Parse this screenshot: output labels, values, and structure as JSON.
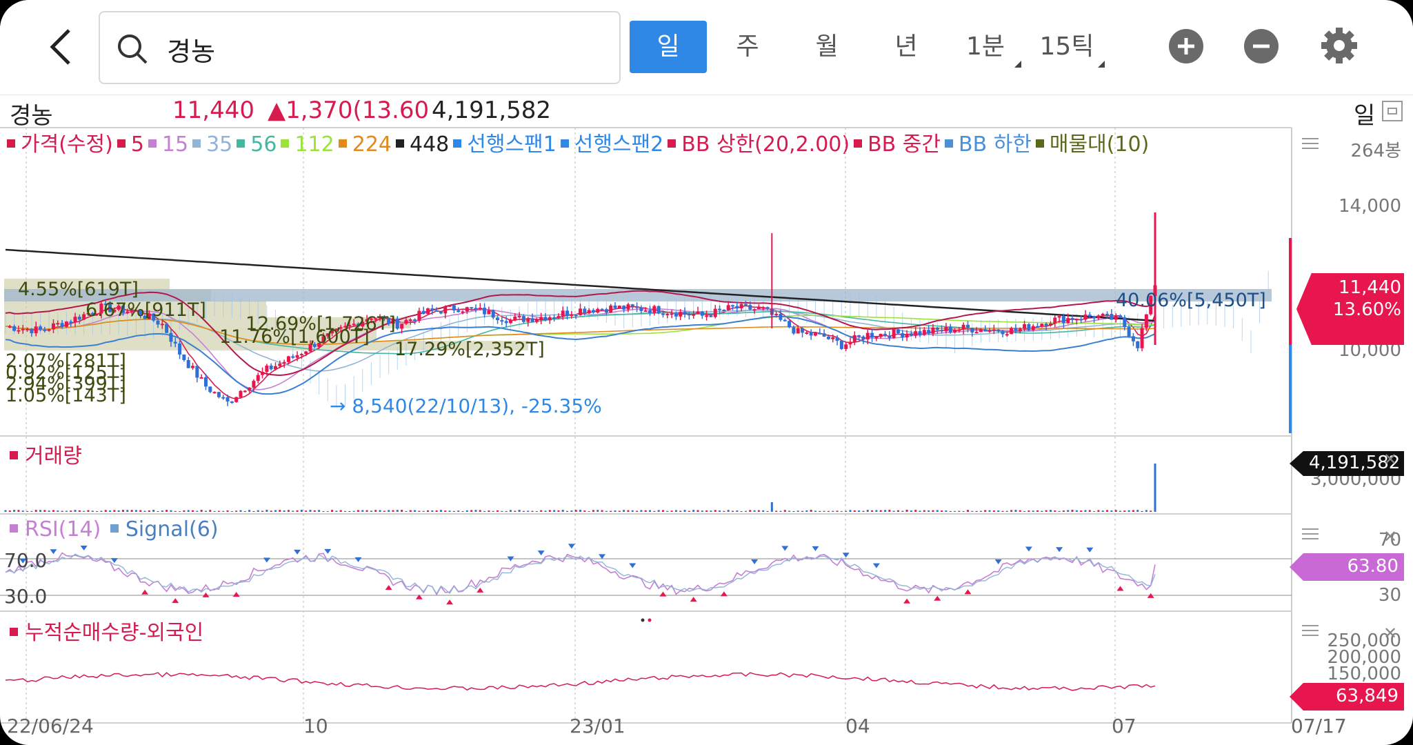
{
  "search": {
    "query": "경농"
  },
  "periods": [
    {
      "label": "일",
      "active": true
    },
    {
      "label": "주"
    },
    {
      "label": "월"
    },
    {
      "label": "년"
    },
    {
      "label": "1분"
    },
    {
      "label": "15틱"
    }
  ],
  "quote": {
    "name": "경농",
    "price": "11,440",
    "change": "▲1,370(13.60",
    "volume": "4,191,582",
    "period": "일"
  },
  "legend": [
    {
      "label": "가격(수정)",
      "color": "#d61b4f"
    },
    {
      "label": "5",
      "color": "#d61b4f"
    },
    {
      "label": "15",
      "color": "#c77fd6"
    },
    {
      "label": "35",
      "color": "#8fb4d6"
    },
    {
      "label": "56",
      "color": "#45b6a0"
    },
    {
      "label": "112",
      "color": "#9be33b"
    },
    {
      "label": "224",
      "color": "#e38a1c"
    },
    {
      "label": "448",
      "color": "#222222"
    },
    {
      "label": "선행스팬1",
      "color": "#2f88e6"
    },
    {
      "label": "선행스팬2",
      "color": "#2f88e6"
    },
    {
      "label": "BB 상한(20,2.00)",
      "color": "#d61b4f"
    },
    {
      "label": "BB 중간",
      "color": "#d61b4f"
    },
    {
      "label": "BB 하한",
      "color": "#4a90d9"
    },
    {
      "label": "매물대(10)",
      "color": "#5a6a1a"
    }
  ],
  "price_axis": {
    "count": "264봉",
    "ticks": [
      "14,000",
      "10,000"
    ],
    "current": "11,440",
    "current_pct": "13.60%"
  },
  "annotations": {
    "low": "8,540(22/10/13), -25.35%",
    "volume_profile": [
      "4.55%[619T]",
      "6.67%[911T]",
      "12.69%[1,726T]",
      "11.76%[1,600T]",
      "17.29%[2,352T]",
      "2.07%[281T]",
      "0.92%[125T]",
      "2.94%[399T]",
      "1.05%[143T]",
      "40.06%[5,450T]"
    ]
  },
  "volume_pane": {
    "title": "거래량",
    "axis": "3,000,000",
    "current": "4,191,582"
  },
  "rsi_pane": {
    "title_rsi": "RSI(14)",
    "title_signal": "Signal(6)",
    "level_high": "70.0",
    "level_low": "30.0",
    "axis_high": "70",
    "axis_low": "30",
    "current": "63.80"
  },
  "foreign_pane": {
    "title": "누적순매수량-외국인",
    "ticks": [
      "250,000",
      "200,000",
      "150,000"
    ],
    "current": "63,849"
  },
  "x_axis": [
    "22/06/24",
    "10",
    "23/01",
    "04",
    "07",
    "07/17"
  ],
  "chart_data": {
    "type": "line",
    "title": "",
    "close_points": [
      [
        0,
        10450
      ],
      [
        8,
        10350
      ],
      [
        15,
        10600
      ],
      [
        22,
        10900
      ],
      [
        30,
        10800
      ],
      [
        36,
        10500
      ],
      [
        40,
        9800
      ],
      [
        46,
        9000
      ],
      [
        51,
        8600
      ],
      [
        54,
        8900
      ],
      [
        60,
        9400
      ],
      [
        66,
        9700
      ],
      [
        72,
        10100
      ],
      [
        78,
        10400
      ],
      [
        84,
        10700
      ],
      [
        90,
        10500
      ],
      [
        97,
        10800
      ],
      [
        104,
        10900
      ],
      [
        110,
        10800
      ],
      [
        116,
        10600
      ],
      [
        125,
        10700
      ],
      [
        132,
        10850
      ],
      [
        140,
        10900
      ],
      [
        150,
        10850
      ],
      [
        160,
        10700
      ],
      [
        167,
        10900
      ],
      [
        174,
        10850
      ],
      [
        182,
        10300
      ],
      [
        188,
        10200
      ],
      [
        192,
        10000
      ],
      [
        198,
        10250
      ],
      [
        210,
        10300
      ],
      [
        220,
        10400
      ],
      [
        232,
        10350
      ],
      [
        240,
        10600
      ],
      [
        250,
        10700
      ],
      [
        256,
        10600
      ],
      [
        260,
        10000
      ],
      [
        264,
        11440
      ]
    ],
    "ylim": [
      8000,
      14500
    ],
    "yticks": [
      10000,
      14000
    ],
    "rsi_levels": [
      30,
      70
    ],
    "rsi_last": 63.8,
    "foreign_last": 63849,
    "volume_last": 4191582
  }
}
